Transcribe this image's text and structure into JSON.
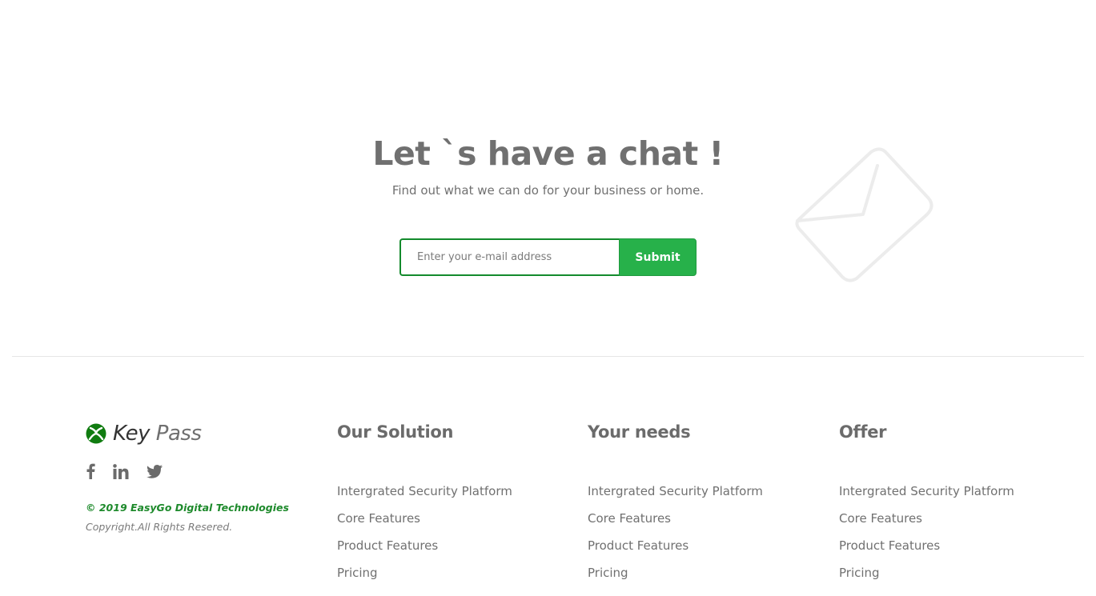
{
  "cta": {
    "title": "Let `s have a chat !",
    "subtitle": "Find out what we can do for your business or home.",
    "email_placeholder": "Enter your e-mail address",
    "email_value": "",
    "submit_label": "Submit"
  },
  "brand": {
    "name_part1": "Key",
    "name_part2": "Pass",
    "logo_color": "#107c10"
  },
  "social": [
    "facebook-icon",
    "linkedin-icon",
    "twitter-icon"
  ],
  "copyright": "© 2019 EasyGo Digital Technologies",
  "rights": "Copyright.All Rights Resered.",
  "columns": [
    {
      "title": "Our Solution",
      "links": [
        "Intergrated Security Platform",
        "Core Features",
        "Product Features",
        "Pricing"
      ]
    },
    {
      "title": "Your needs",
      "links": [
        "Intergrated Security Platform",
        "Core Features",
        "Product Features",
        "Pricing"
      ]
    },
    {
      "title": "Offer",
      "links": [
        "Intergrated Security Platform",
        "Core Features",
        "Product Features",
        "Pricing"
      ]
    }
  ],
  "colors": {
    "accent": "#27b14a",
    "input_border": "#138a2c",
    "copyright_green": "#1e8a2c"
  }
}
